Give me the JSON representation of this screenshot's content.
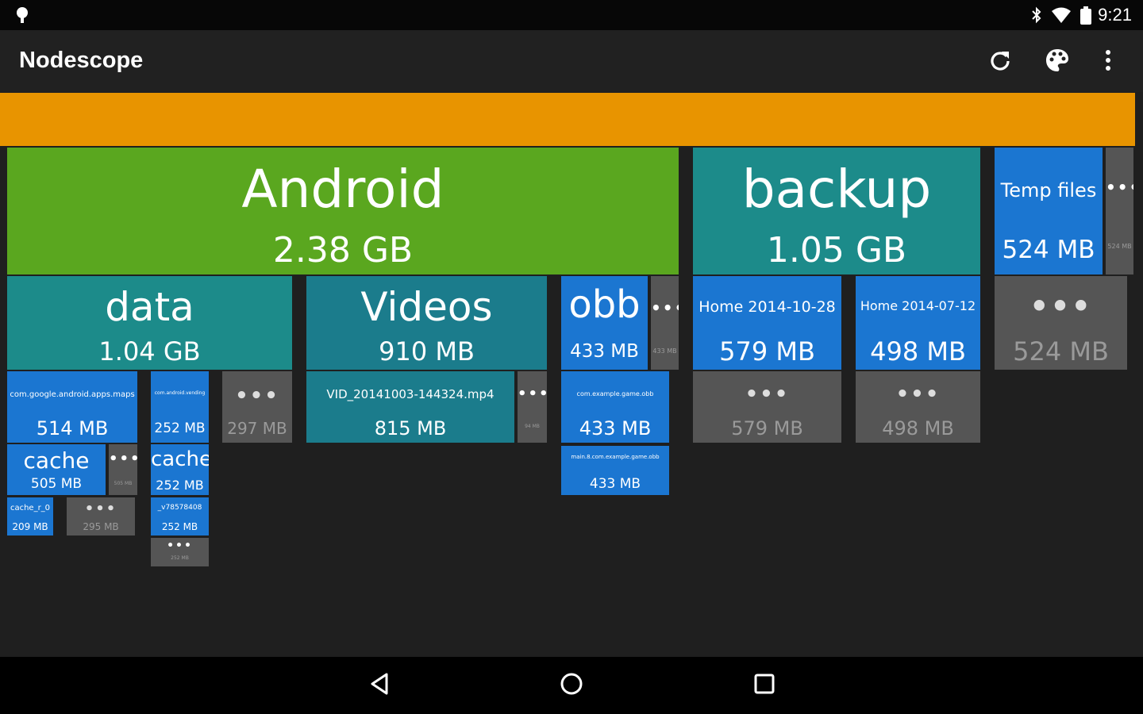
{
  "status_bar": {
    "time": "9:21",
    "left_icon": "android-debug-icon",
    "icons": [
      "bluetooth-icon",
      "wifi-icon",
      "battery-icon"
    ]
  },
  "app_bar": {
    "title": "Nodescope",
    "actions": [
      "refresh-icon",
      "palette-icon",
      "overflow-menu-icon"
    ]
  },
  "treemap": {
    "root": {
      "color": "#e89400"
    },
    "android": {
      "name": "Android",
      "size": "2.38 GB"
    },
    "backup": {
      "name": "backup",
      "size": "1.05 GB"
    },
    "temp": {
      "name": "Temp files",
      "size": "524 MB",
      "more": "•••",
      "tiny": "524 MB"
    },
    "data": {
      "name": "data",
      "size": "1.04 GB"
    },
    "videos": {
      "name": "Videos",
      "size": "910 MB"
    },
    "obb": {
      "name": "obb",
      "size": "433 MB",
      "more": "•••",
      "tiny": "433 MB"
    },
    "home1": {
      "name": "Home 2014-10-28",
      "size": "579 MB"
    },
    "home2": {
      "name": "Home 2014-07-12",
      "size": "498 MB"
    },
    "more_backup": {
      "dots": "•••",
      "size": "524 MB"
    },
    "maps": {
      "name": "com.google.android.apps.maps",
      "size": "514 MB"
    },
    "data2": {
      "name": "com.android.vending",
      "size": "252 MB"
    },
    "more_data": {
      "dots": "•••",
      "size": "297 MB"
    },
    "cache1": {
      "name": "cache",
      "size": "505 MB"
    },
    "cache1_more": {
      "dots": "•••",
      "size": "505 MB"
    },
    "cache_sub": {
      "name": "cache_r_0",
      "size": "209 MB"
    },
    "cache_more": {
      "dots": "•••",
      "size": "295 MB"
    },
    "cache2": {
      "name": "cache",
      "size": "252 MB"
    },
    "cache2_sub": {
      "name": "_v78578408",
      "size": "252 MB"
    },
    "cache2_more": {
      "dots": "•••",
      "size": "252 MB"
    },
    "vid": {
      "name": "VID_20141003-144324.mp4",
      "size": "815 MB"
    },
    "vid_more": {
      "dots": "•••",
      "size": "94 MB"
    },
    "obb_sub": {
      "name": "com.example.game.obb",
      "size": "433 MB"
    },
    "obb_sub2": {
      "name": "main.8.com.example.game.obb",
      "size": "433 MB"
    },
    "home1_more": {
      "dots": "•••",
      "size": "579 MB"
    },
    "home2_more": {
      "dots": "•••",
      "size": "498 MB"
    }
  },
  "nav_bar": {
    "buttons": [
      "back-icon",
      "home-icon",
      "recents-icon"
    ]
  }
}
